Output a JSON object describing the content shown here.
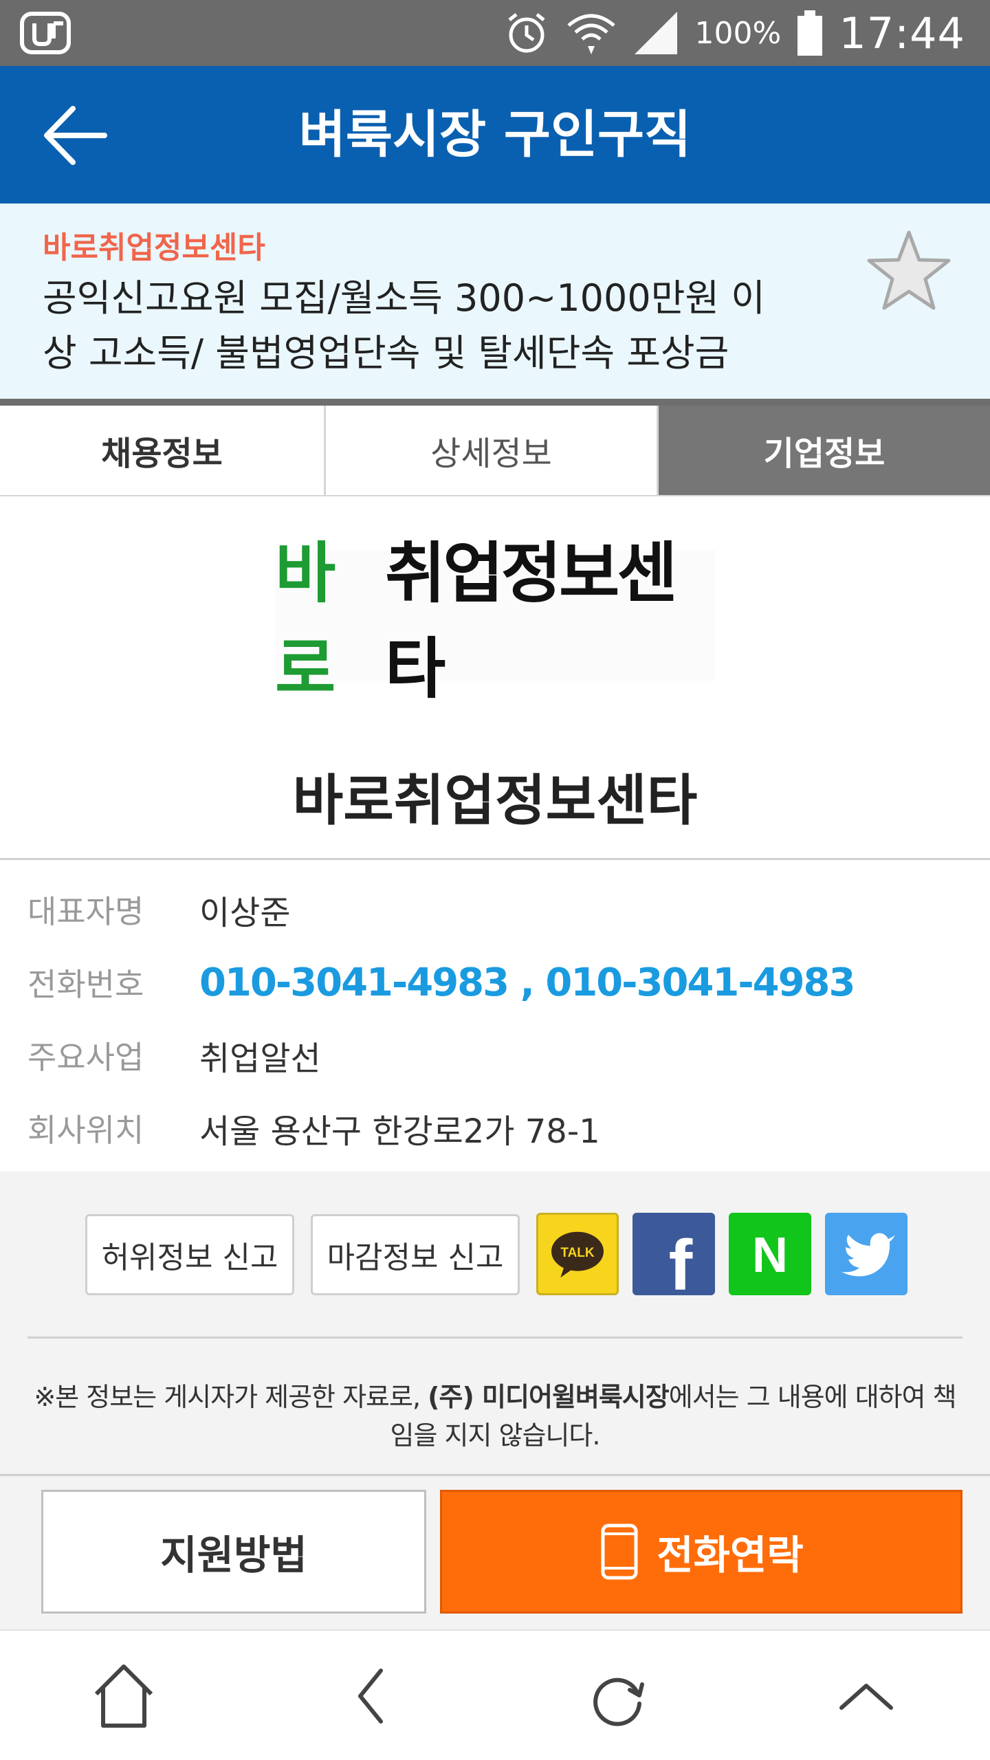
{
  "status_bar": {
    "battery_percent": "100%",
    "time": "17:44"
  },
  "header": {
    "title": "벼룩시장 구인구직"
  },
  "summary": {
    "company": "바로취업정보센타",
    "headline": "공익신고요원 모집/월소득 300~1000만원 이상 고소득/ 불법영업단속 및 탈세단속 포상금"
  },
  "tabs": [
    {
      "label": "채용정보"
    },
    {
      "label": "상세정보"
    },
    {
      "label": "기업정보"
    }
  ],
  "selected_tab": "기업정보",
  "company": {
    "logo_text_green": "바로",
    "logo_text_black": "취업정보센타",
    "name": "바로취업정보센타"
  },
  "info": [
    {
      "label": "대표자명",
      "value": "이상준"
    },
    {
      "label": "전화번호",
      "value": "010-3041-4983 , 010-3041-4983"
    },
    {
      "label": "주요사업",
      "value": "취업알선"
    },
    {
      "label": "회사위치",
      "value": "서울 용산구 한강로2가 78-1"
    }
  ],
  "report_buttons": {
    "false_info": "허위정보 신고",
    "closed_info": "마감정보 신고"
  },
  "share": {
    "kakao_label": "TALK",
    "facebook_label": "f",
    "naver_label": "N"
  },
  "notice": {
    "prefix": "※본 정보는 게시자가 제공한 자료로, ",
    "company": "(주) 미디어윌벼룩시장",
    "suffix": "에서는 그 내용에 대하여 책임을 지지 않습니다."
  },
  "actions": {
    "apply_label": "지원방법",
    "call_label": "전화연락"
  },
  "colors": {
    "header_bg": "#0a60b0",
    "summary_bg": "#eaf7fc",
    "company_accent": "#f0654b",
    "phone_link": "#1a9be0",
    "call_button": "#ff6d0a"
  }
}
